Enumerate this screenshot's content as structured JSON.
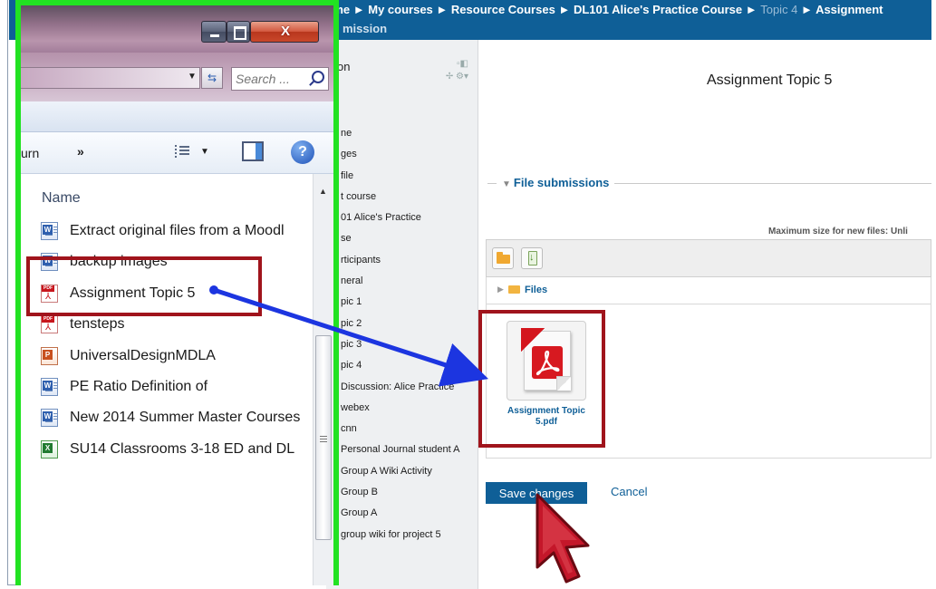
{
  "moodle": {
    "breadcrumb": {
      "home": "Home",
      "sep": "►",
      "my_courses": "My courses",
      "resource_courses": "Resource Courses",
      "course": "DL101 Alice's Practice Course",
      "topic": "Topic 4",
      "assignment": "Assignment",
      "continuation": "mission"
    },
    "nav_block": {
      "title": "on",
      "items": [
        "ne",
        "ges",
        "file",
        "t course",
        "01 Alice's Practice",
        "se",
        "rticipants",
        "neral",
        "pic 1",
        "pic 2",
        "pic 3",
        "pic 4",
        "Discussion: Alice Practice",
        "webex",
        "cnn",
        "Personal Journal student A",
        "Group A Wiki Activity",
        "Group B",
        "Group A",
        "group wiki for project 5"
      ]
    },
    "assignment_title": "Assignment Topic 5",
    "file_submissions_legend": "File submissions",
    "max_size_label": "Maximum size for new files: Unli",
    "path_label": "Files",
    "uploaded_file": "Assignment Topic 5.pdf",
    "save_button": "Save changes",
    "cancel_link": "Cancel"
  },
  "explorer": {
    "window_buttons": {
      "close": "X"
    },
    "search_placeholder": "Search ...",
    "toolbar": {
      "return_label": "urn",
      "more_label": "»",
      "help_label": "?"
    },
    "column_header": "Name",
    "files": [
      {
        "name": "Extract original files from a Moodl",
        "type": "word"
      },
      {
        "name": "backup images",
        "type": "word"
      },
      {
        "name": "Assignment Topic 5",
        "type": "pdf"
      },
      {
        "name": "tensteps",
        "type": "pdf"
      },
      {
        "name": "UniversalDesignMDLA",
        "type": "ppt"
      },
      {
        "name": "PE Ratio Definition of",
        "type": "word"
      },
      {
        "name": "New 2014 Summer Master Courses",
        "type": "word"
      },
      {
        "name": "SU14 Classrooms 3-18 ED and DL",
        "type": "xls"
      }
    ]
  },
  "colors": {
    "moodle_blue": "#0f5f97",
    "highlight_green": "#22e222",
    "highlight_red": "#a0141c",
    "arrow_blue": "#1c35e0",
    "pdf_red": "#d71920"
  }
}
